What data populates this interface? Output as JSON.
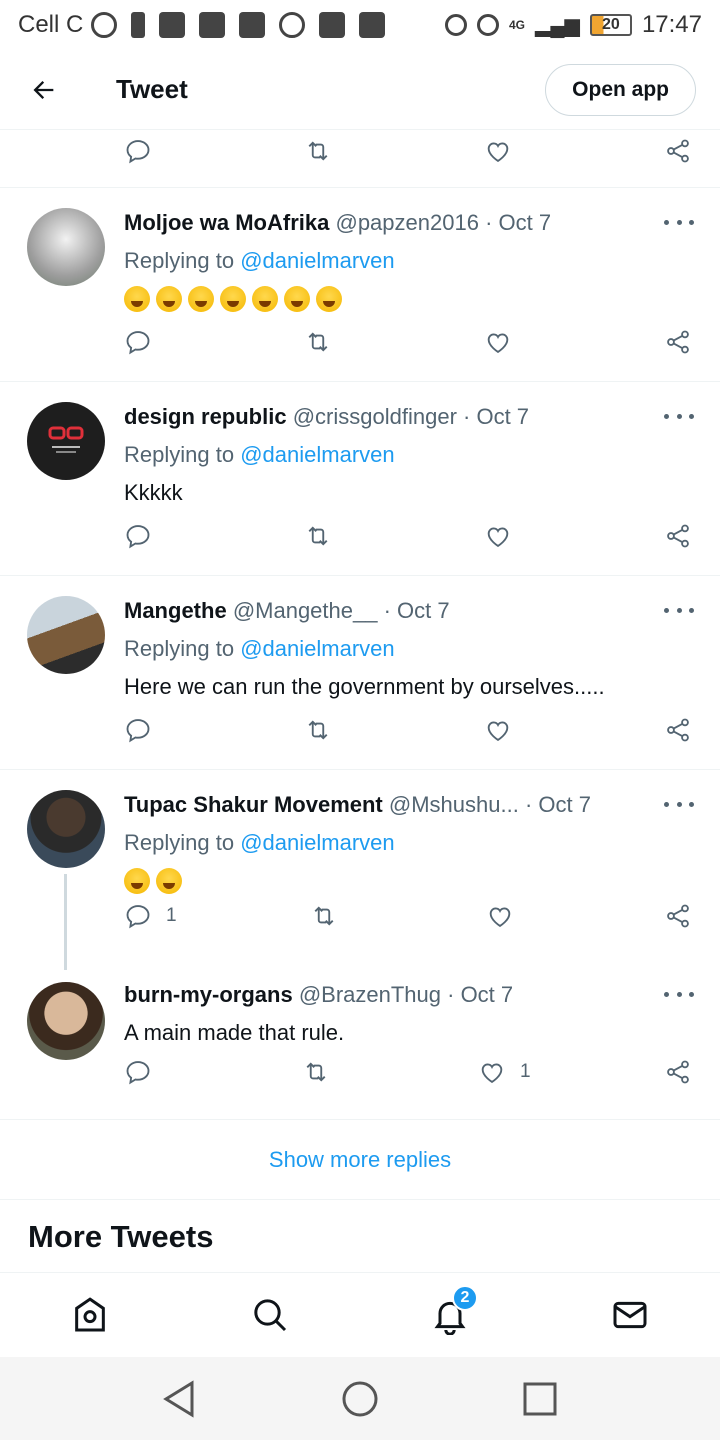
{
  "status_bar": {
    "carrier": "Cell C",
    "battery": "20",
    "time": "17:47",
    "network": "4G"
  },
  "header": {
    "title": "Tweet",
    "open_app": "Open app"
  },
  "tweets": [
    {
      "name": "Moljoe wa MoAfrika",
      "handle": "@papzen2016",
      "date": "· Oct 7",
      "replying_prefix": "Replying to",
      "replying_to": "@danielmarven",
      "emoji": [
        "face-with-tears-of-joy",
        "face-with-tears-of-joy",
        "face-with-tears-of-joy",
        "face-with-tears-of-joy",
        "face-with-tears-of-joy",
        "face-with-tears-of-joy",
        "face-with-tears-of-joy"
      ]
    },
    {
      "name": "design republic",
      "handle": "@crissgoldfinger",
      "date": "· Oct 7",
      "replying_prefix": "Replying to",
      "replying_to": "@danielmarven",
      "text": "Kkkkk"
    },
    {
      "name": "Mangethe",
      "handle": "@Mangethe__",
      "date": "· Oct 7",
      "replying_prefix": "Replying to",
      "replying_to": "@danielmarven",
      "text": "Here we can run the government by ourselves....."
    },
    {
      "name": "Tupac Shakur Movement",
      "handle": "@Mshushu...",
      "date": "· Oct 7",
      "replying_prefix": "Replying to",
      "replying_to": "@danielmarven",
      "emoji": [
        "grinning-face",
        "grinning-face"
      ],
      "reply_count": "1"
    },
    {
      "name": "burn-my-organs",
      "handle": "@BrazenThug",
      "date": "· Oct 7",
      "text": "A main made that rule.",
      "like_count": "1"
    }
  ],
  "show_more": "Show more replies",
  "more_tweets": "More Tweets",
  "tabbar": {
    "notifications_badge": "2"
  },
  "colors": {
    "accent": "#1d9bf0",
    "text": "#0f1419",
    "muted": "#536471"
  }
}
